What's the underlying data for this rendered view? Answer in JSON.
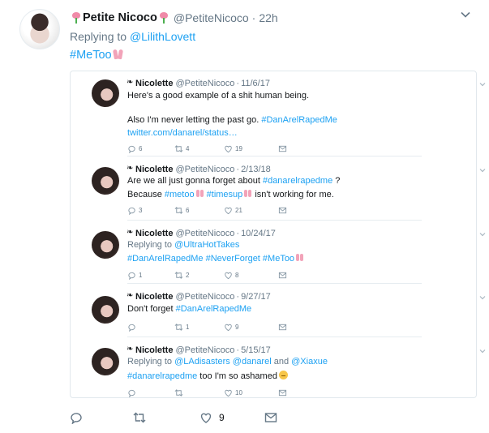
{
  "tweet": {
    "name": "Petite Nicoco",
    "handle": "@PetiteNicoco",
    "separator": "·",
    "time": "22h",
    "reply_prefix": "Replying to ",
    "reply_to": "@LilithLovett",
    "text": "#MeToo",
    "actions": {
      "retweets": "",
      "likes": "9"
    }
  },
  "thread": [
    {
      "name": "Nicolette",
      "handle": "@PetiteNicoco",
      "time": "11/6/17",
      "lines": [
        {
          "text": "Here's a good example of a shit human being."
        },
        {
          "text": ""
        },
        {
          "text": "Also I'm never letting the past go. ",
          "tag": "#DanArelRapedMe"
        },
        {
          "link": "twitter.com/danarel/status…"
        }
      ],
      "replies": "6",
      "retweets": "4",
      "likes": "19"
    },
    {
      "name": "Nicolette",
      "handle": "@PetiteNicoco",
      "time": "2/13/18",
      "line1_pre": "Are we all just gonna forget about ",
      "line1_tag": "#danarelrapedme",
      "line1_post": " ?",
      "line2_pre": "Because ",
      "line2_tag1": "#metoo",
      "line2_tag2": "#timesup",
      "line2_post": " isn't working for me.",
      "replies": "3",
      "retweets": "6",
      "likes": "21"
    },
    {
      "name": "Nicolette",
      "handle": "@PetiteNicoco",
      "time": "10/24/17",
      "reply_prefix": "Replying to ",
      "reply_to": "@UltraHotTakes",
      "tags": "#DanArelRapedMe #NeverForget #MeToo",
      "replies": "1",
      "retweets": "2",
      "likes": "8"
    },
    {
      "name": "Nicolette",
      "handle": "@PetiteNicoco",
      "time": "9/27/17",
      "text_pre": "Don't forget ",
      "text_tag": "#DanArelRapedMe",
      "replies": "",
      "retweets": "1",
      "likes": "9"
    },
    {
      "name": "Nicolette",
      "handle": "@PetiteNicoco",
      "time": "5/15/17",
      "reply_prefix": "Replying to ",
      "reply_to1": "@LAdisasters",
      "reply_to2": "@danarel",
      "reply_and": " and ",
      "reply_to3": "@Xiaxue",
      "text_tag": "#danarelrapedme",
      "text_post": " too I'm so ashamed",
      "replies": "",
      "retweets": "",
      "likes": "10"
    }
  ],
  "icons": {
    "reply": "reply-icon",
    "retweet": "retweet-icon",
    "like": "heart-icon",
    "dm": "envelope-icon",
    "caret": "chevron-down-icon"
  },
  "colors": {
    "accent": "#1da1f2",
    "muted": "#657786",
    "text": "#14171a",
    "border": "#e1e8ed"
  }
}
